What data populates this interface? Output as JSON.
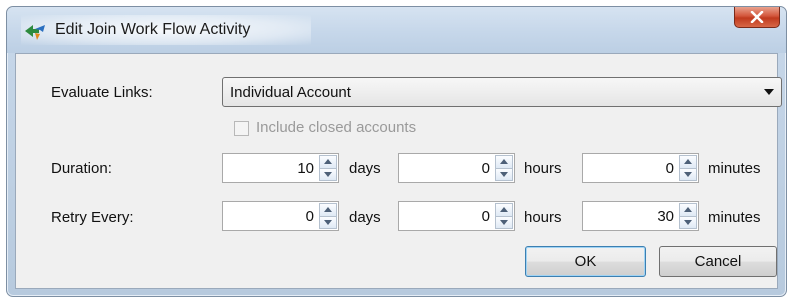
{
  "window": {
    "title": "Edit Join Work Flow Activity",
    "close_icon": "close-icon",
    "app_icon": "workflow-arrow-icon"
  },
  "form": {
    "evaluate_links_label": "Evaluate Links:",
    "evaluate_links_value": "Individual Account",
    "include_closed_label": "Include closed accounts",
    "include_closed_checked": false,
    "include_closed_enabled": false,
    "duration": {
      "label": "Duration:",
      "days": "10",
      "hours": "0",
      "minutes": "0"
    },
    "retry": {
      "label": "Retry Every:",
      "days": "0",
      "hours": "0",
      "minutes": "30"
    },
    "units": {
      "days": "days",
      "hours": "hours",
      "minutes": "minutes"
    }
  },
  "buttons": {
    "ok": "OK",
    "cancel": "Cancel"
  },
  "colors": {
    "close_button": "#c8452a",
    "default_button_border": "#3c7fb1"
  }
}
